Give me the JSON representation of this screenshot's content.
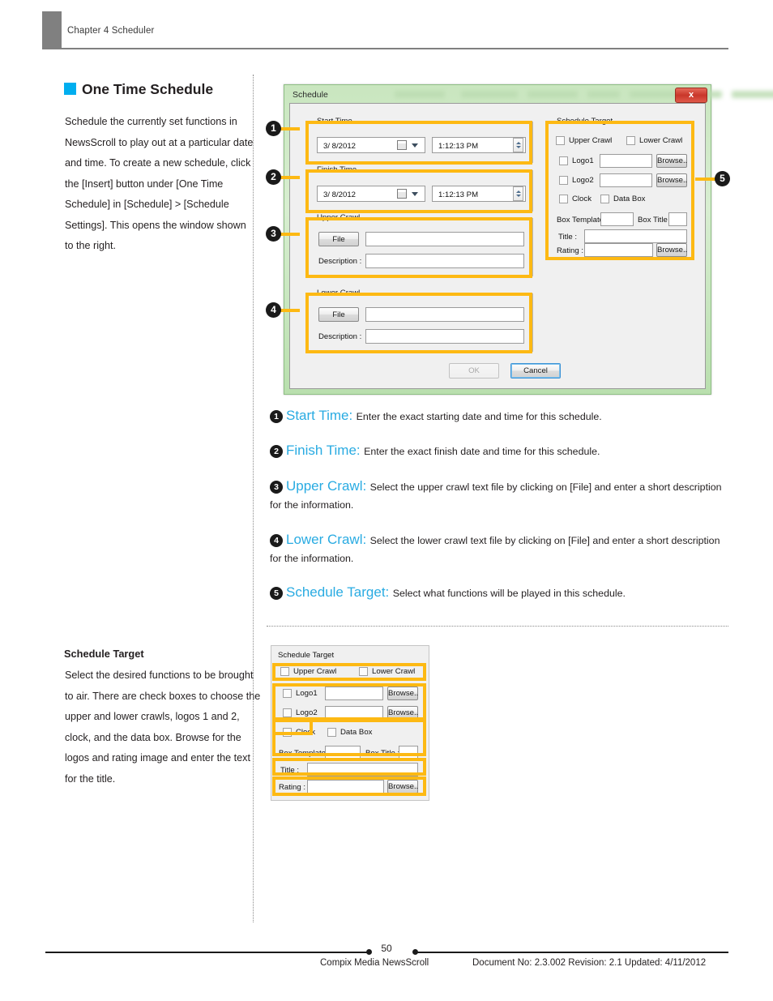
{
  "page": {
    "chapter_header": "Chapter 4 Scheduler",
    "page_number": "50",
    "footer_left": "Compix Media NewsScroll",
    "footer_right": "Document No: 2.3.002 Revision: 2.1 Updated: 4/11/2012",
    "accent_color": "#00aeef",
    "highlight_color": "#fdb913",
    "term_color": "#29abe2"
  },
  "left": {
    "section_title": "One Time Schedule",
    "intro_paragraph": "Schedule the currently set functions in NewsScroll to play out at a particular date and time. To create a new schedule, click the [Insert] button under [One Time Schedule] in [Schedule] > [Schedule Settings]. This opens the window shown to the right.",
    "subsection_title": "Schedule Target",
    "subsection_paragraph": "Select the desired functions to be brought to air. There are check boxes to choose the upper and lower crawls, logos 1 and 2, clock, and the data box. Browse for the logos and rating image and enter the text for the title."
  },
  "dialog": {
    "title": "Schedule",
    "close_label": "x",
    "start_time": {
      "group_label": "Start Time",
      "date_value": "3/ 8/2012",
      "time_value": "1:12:13 PM"
    },
    "finish_time": {
      "group_label": "Finish Time",
      "date_value": "3/ 8/2012",
      "time_value": "1:12:13 PM"
    },
    "upper_crawl": {
      "group_label": "Upper Crawl",
      "file_button": "File",
      "file_value": "",
      "description_label": "Description :",
      "description_value": ""
    },
    "lower_crawl": {
      "group_label": "Lower Crawl",
      "file_button": "File",
      "file_value": "",
      "description_label": "Description :",
      "description_value": ""
    },
    "schedule_target": {
      "group_label": "Schedule Target",
      "upper_crawl_label": "Upper Crawl",
      "lower_crawl_label": "Lower Crawl",
      "logo1_label": "Logo1",
      "logo1_value": "",
      "logo1_browse": "Browse..",
      "logo2_label": "Logo2",
      "logo2_value": "",
      "logo2_browse": "Browse..",
      "clock_label": "Clock",
      "data_box_label": "Data Box",
      "box_template_label": "Box Template :",
      "box_template_value": "",
      "box_title_label": "Box Title :",
      "box_title_value": "",
      "title_label": "Title :",
      "title_value": "",
      "rating_label": "Rating :",
      "rating_value": "",
      "rating_browse": "Browse.."
    },
    "ok_button": "OK",
    "cancel_button": "Cancel"
  },
  "callouts": {
    "n1": "1",
    "n2": "2",
    "n3": "3",
    "n4": "4",
    "n5": "5"
  },
  "legend": [
    {
      "num": "1",
      "term": "Start Time:",
      "desc": "Enter the exact starting date and time for this schedule."
    },
    {
      "num": "2",
      "term": "Finish Time:",
      "desc": "Enter the exact finish date and time for this schedule."
    },
    {
      "num": "3",
      "term": "Upper Crawl:",
      "desc": "Select the upper crawl text file by clicking on [File] and enter a short description for the information."
    },
    {
      "num": "4",
      "term": "Lower Crawl:",
      "desc": "Select the lower crawl text file by clicking on [File] and enter a short description for the information."
    },
    {
      "num": "5",
      "term": "Schedule Target:",
      "desc": "Select what functions will be played in this schedule."
    }
  ],
  "target_panel": {
    "group_label": "Schedule Target",
    "upper_crawl_label": "Upper Crawl",
    "lower_crawl_label": "Lower Crawl",
    "logo1_label": "Logo1",
    "logo1_value": "",
    "logo1_browse": "Browse..",
    "logo2_label": "Logo2",
    "logo2_value": "",
    "logo2_browse": "Browse..",
    "clock_label": "Clock",
    "data_box_label": "Data Box",
    "box_template_label": "Box Template :",
    "box_template_value": "",
    "box_title_label": "Box Title :",
    "box_title_value": "",
    "title_label": "Title :",
    "title_value": "",
    "rating_label": "Rating :",
    "rating_value": "",
    "rating_browse": "Browse.."
  }
}
